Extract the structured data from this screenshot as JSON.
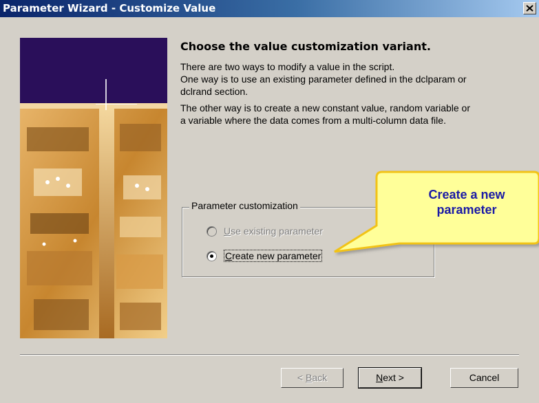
{
  "window": {
    "title": "Parameter Wizard - Customize Value"
  },
  "content": {
    "heading": "Choose the value customization variant.",
    "para1_line1": "There are two ways to modify a value in the script.",
    "para1_line2": "One way is to use an existing parameter defined in the dclparam or",
    "para1_line3": "dclrand section.",
    "para2_line1": "The other way is to create a new constant value, random variable or",
    "para2_line2": "a variable where the data comes from a multi-column data file."
  },
  "group": {
    "label": "Parameter customization",
    "options": [
      {
        "label_hotkey": "U",
        "label_rest": "se existing parameter",
        "enabled": false,
        "selected": false
      },
      {
        "label_hotkey": "C",
        "label_rest": "reate new parameter",
        "enabled": true,
        "selected": true
      }
    ]
  },
  "callout": {
    "line1": "Create a new",
    "line2": "parameter",
    "fill_color": "#ffff99",
    "text_color": "#1a1aa6"
  },
  "buttons": {
    "back_prefix": "< ",
    "back_hotkey": "B",
    "back_rest": "ack",
    "next_hotkey": "N",
    "next_rest": "ext >",
    "cancel": "Cancel"
  },
  "icons": {
    "close": "close-icon"
  }
}
